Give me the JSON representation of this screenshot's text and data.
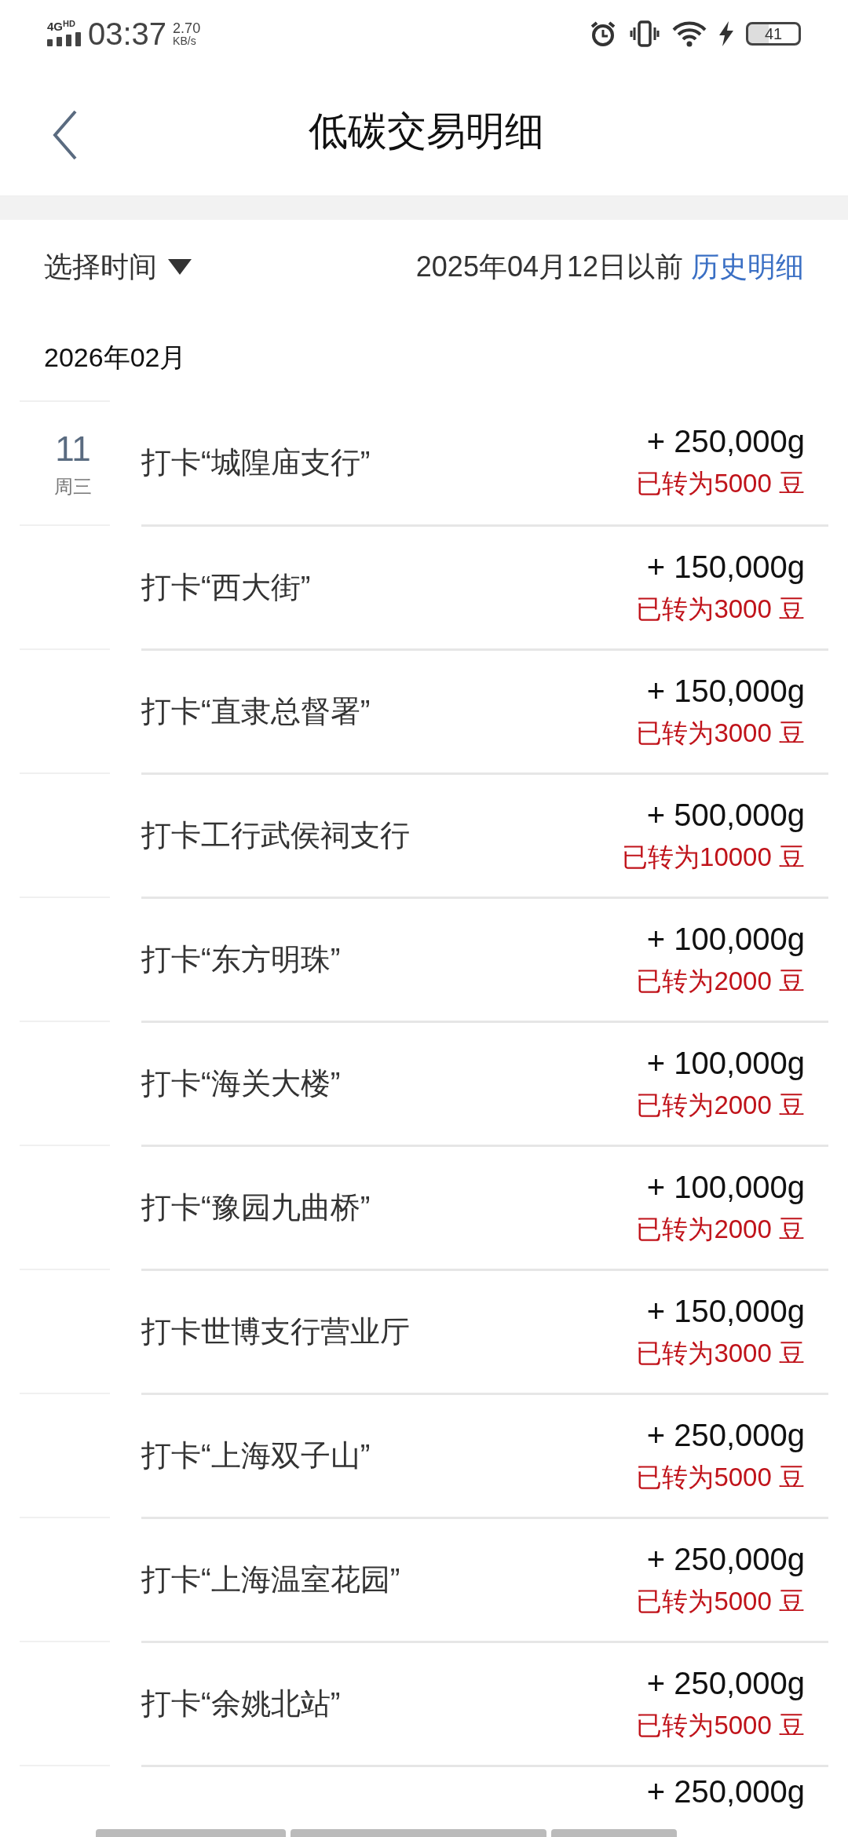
{
  "status_bar": {
    "network": "4G",
    "network_badge": "HD",
    "time": "03:37",
    "speed_value": "2.70",
    "speed_unit": "KB/s",
    "battery": "41"
  },
  "header": {
    "title": "低碳交易明细"
  },
  "filter": {
    "select_label": "选择时间",
    "before_text": "2025年04月12日以前",
    "history_link": "历史明细"
  },
  "month": "2026年02月",
  "rows": [
    {
      "day": "11",
      "weekday": "周三",
      "title": "打卡“城隍庙支行”",
      "amount": "+ 250,000g",
      "note": "已转为5000 豆"
    },
    {
      "title": "打卡“西大街”",
      "amount": "+ 150,000g",
      "note": "已转为3000 豆"
    },
    {
      "title": "打卡“直隶总督署”",
      "amount": "+ 150,000g",
      "note": "已转为3000 豆"
    },
    {
      "title": "打卡工行武侯祠支行",
      "amount": "+ 500,000g",
      "note": "已转为10000 豆"
    },
    {
      "title": "打卡“东方明珠”",
      "amount": "+ 100,000g",
      "note": "已转为2000 豆"
    },
    {
      "title": "打卡“海关大楼”",
      "amount": "+ 100,000g",
      "note": "已转为2000 豆"
    },
    {
      "title": "打卡“豫园九曲桥”",
      "amount": "+ 100,000g",
      "note": "已转为2000 豆"
    },
    {
      "title": "打卡世博支行营业厅",
      "amount": "+ 150,000g",
      "note": "已转为3000 豆"
    },
    {
      "title": "打卡“上海双子山”",
      "amount": "+ 250,000g",
      "note": "已转为5000 豆"
    },
    {
      "title": "打卡“上海温室花园”",
      "amount": "+ 250,000g",
      "note": "已转为5000 豆"
    },
    {
      "title": "打卡“余姚北站”",
      "amount": "+ 250,000g",
      "note": "已转为5000 豆"
    },
    {
      "amount": "+ 250,000g"
    }
  ]
}
